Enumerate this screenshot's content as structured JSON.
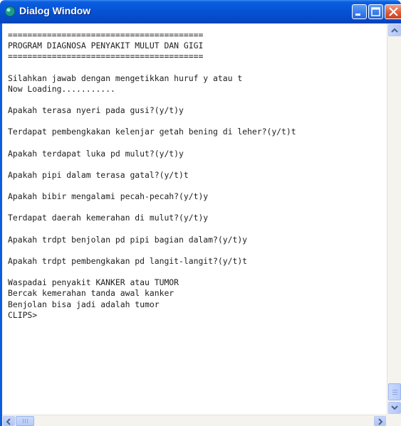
{
  "window": {
    "title": "Dialog Window",
    "icon": "clips-app-icon",
    "title_bar_color": "#0652d4",
    "close_button_color": "#e06040"
  },
  "console": {
    "text_color": "#202020",
    "background": "#ffffff",
    "lines": [
      "========================================",
      "PROGRAM DIAGNOSA PENYAKIT MULUT DAN GIGI",
      "========================================",
      "",
      "Silahkan jawab dengan mengetikkan huruf y atau t",
      "Now Loading...........",
      "",
      "Apakah terasa nyeri pada gusi?(y/t)y",
      "",
      "Terdapat pembengkakan kelenjar getah bening di leher?(y/t)t",
      "",
      "Apakah terdapat luka pd mulut?(y/t)y",
      "",
      "Apakah pipi dalam terasa gatal?(y/t)t",
      "",
      "Apakah bibir mengalami pecah-pecah?(y/t)y",
      "",
      "Terdapat daerah kemerahan di mulut?(y/t)y",
      "",
      "Apakah trdpt benjolan pd pipi bagian dalam?(y/t)y",
      "",
      "Apakah trdpt pembengkakan pd langit-langit?(y/t)t",
      "",
      "Waspadai penyakit KANKER atau TUMOR",
      "Bercak kemerahan tanda awal kanker",
      "Benjolan bisa jadi adalah tumor",
      "CLIPS>"
    ]
  }
}
